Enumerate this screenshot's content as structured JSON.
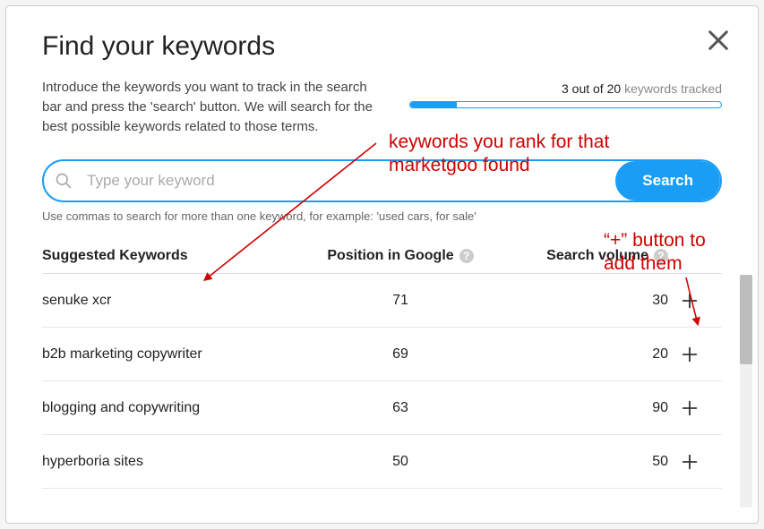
{
  "modal": {
    "title": "Find your keywords",
    "intro": "Introduce the keywords you want to track in the search bar and press the 'search' button. We will search for the best possible keywords related to those terms.",
    "tracked_used": 3,
    "tracked_total": 20,
    "tracked_units": "keywords tracked",
    "tracked_label_prefix": "out of",
    "progress_pct": 15
  },
  "search": {
    "placeholder": "Type your keyword",
    "button": "Search",
    "hint": "Use commas to search for more than one keyword, for example: 'used cars, for sale'"
  },
  "table": {
    "headers": {
      "keyword": "Suggested Keywords",
      "position": "Position in Google",
      "volume": "Search volume"
    },
    "rows": [
      {
        "keyword": "senuke xcr",
        "position": 71,
        "volume": 30
      },
      {
        "keyword": "b2b marketing copywriter",
        "position": 69,
        "volume": 20
      },
      {
        "keyword": "blogging and copywriting",
        "position": 63,
        "volume": 90
      },
      {
        "keyword": "hyperboria sites",
        "position": 50,
        "volume": 50
      }
    ]
  },
  "annotations": {
    "a1_line1": "keywords you rank for that",
    "a1_line2": "marketgoo found",
    "a2_line1": "“+” button to",
    "a2_line2": "add them"
  }
}
